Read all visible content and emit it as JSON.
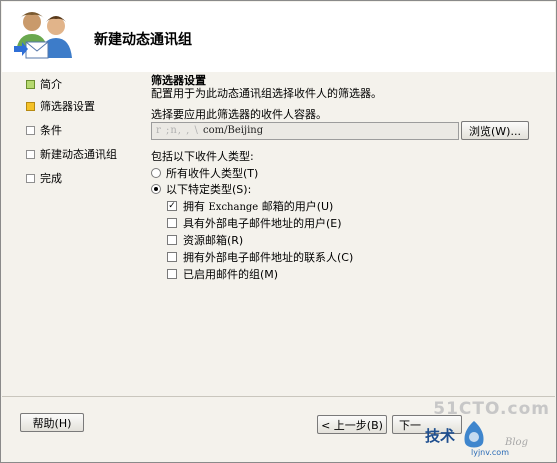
{
  "header": {
    "title": "新建动态通讯组"
  },
  "sidebar": {
    "items": [
      {
        "label": "简介",
        "state": "done"
      },
      {
        "label": "筛选器设置",
        "state": "current"
      },
      {
        "label": "条件",
        "state": "pending"
      },
      {
        "label": "新建动态通讯组",
        "state": "pending"
      },
      {
        "label": "完成",
        "state": "pending"
      }
    ]
  },
  "content": {
    "title": "筛选器设置",
    "description": "配置用于为此动态通讯组选择收件人的筛选器。",
    "container_label": "选择要应用此筛选器的收件人容器。",
    "container_path_obscured": "r ;n,  ,  \\ ",
    "container_path": "com/Beijing",
    "browse_label": "浏览(W)...",
    "include_label": "包括以下收件人类型:",
    "radio_all": "所有收件人类型(T)",
    "radio_specific": "以下特定类型(S):",
    "checkboxes": [
      {
        "prefix": "拥有 ",
        "latin": "Exchange",
        "suffix": " 邮箱的用户(U)",
        "checked": true
      },
      {
        "prefix": "具有外部电子邮件地址的用户(E)",
        "latin": "",
        "suffix": "",
        "checked": false
      },
      {
        "prefix": "资源邮箱(R)",
        "latin": "",
        "suffix": "",
        "checked": false
      },
      {
        "prefix": "拥有外部电子邮件地址的联系人(C)",
        "latin": "",
        "suffix": "",
        "checked": false
      },
      {
        "prefix": "已启用邮件的组(M)",
        "latin": "",
        "suffix": "",
        "checked": false
      }
    ]
  },
  "footer": {
    "help_label": "帮助(H)",
    "back_label": "< 上一步(B)",
    "next_label": "下一"
  },
  "watermark": {
    "site": "51CTO.com",
    "tech": "技术",
    "blog": "Blog",
    "url": "lyjnv.com"
  },
  "colors": {
    "done_marker": "#b6d96f",
    "current_marker": "#f5c227",
    "window_bg": "#f4f2ec"
  }
}
